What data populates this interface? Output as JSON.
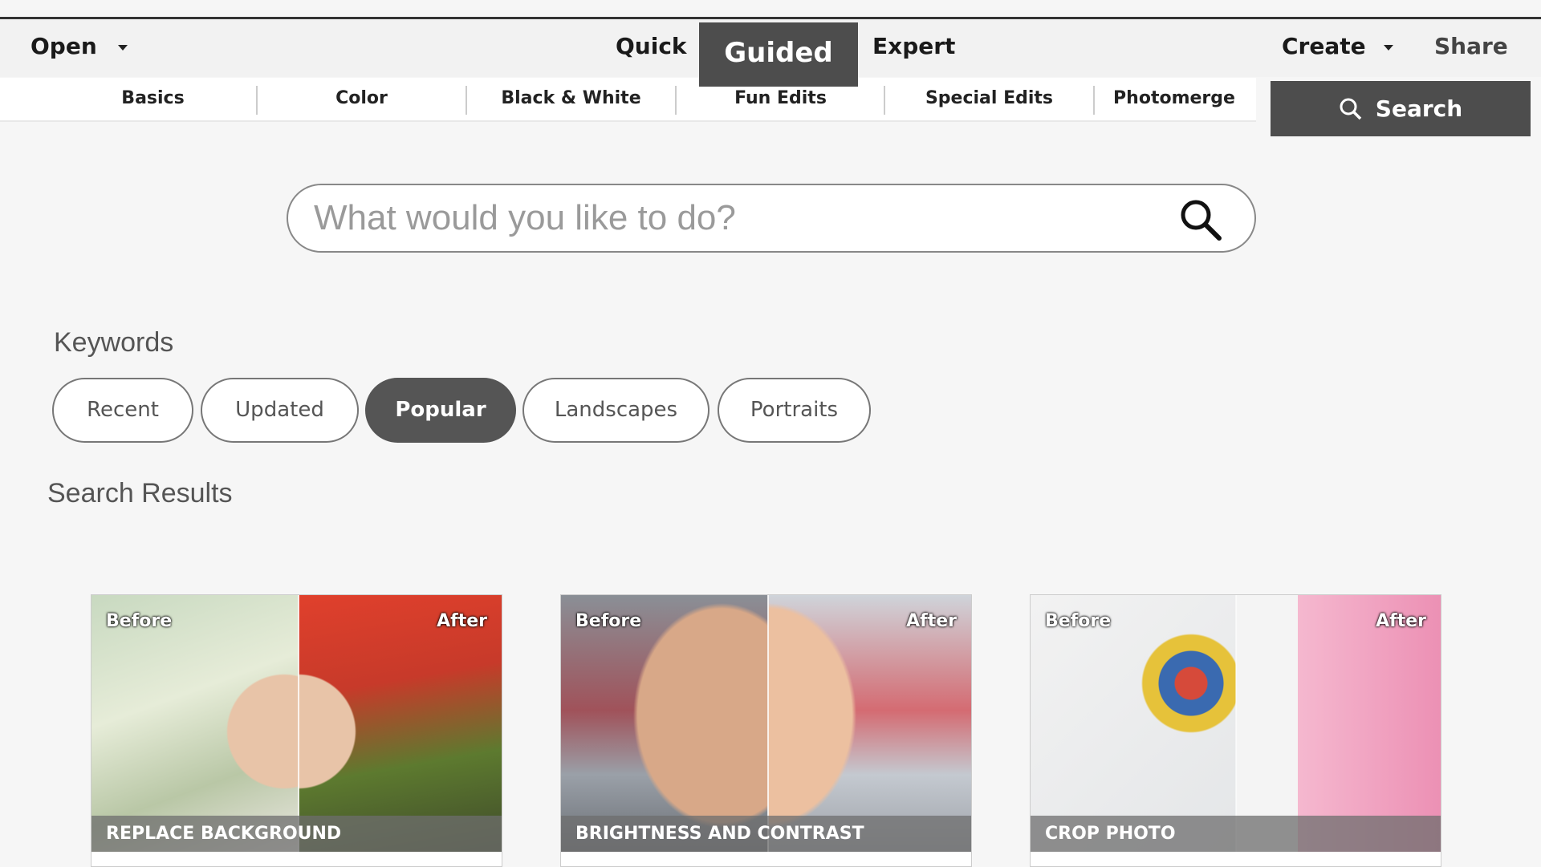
{
  "header": {
    "open": "Open",
    "modes": [
      "Quick",
      "Guided",
      "Expert"
    ],
    "active_mode": "Guided",
    "create": "Create",
    "share": "Share"
  },
  "subnav": {
    "items": [
      "Basics",
      "Color",
      "Black & White",
      "Fun Edits",
      "Special Edits",
      "Photomerge"
    ],
    "search_button": "Search"
  },
  "search": {
    "placeholder": "What would you like to do?",
    "value": ""
  },
  "keywords": {
    "title": "Keywords",
    "items": [
      "Recent",
      "Updated",
      "Popular",
      "Landscapes",
      "Portraits"
    ],
    "active": "Popular"
  },
  "results": {
    "title": "Search Results",
    "before_label": "Before",
    "after_label": "After",
    "cards": [
      {
        "title": "REPLACE BACKGROUND"
      },
      {
        "title": "BRIGHTNESS AND CONTRAST"
      },
      {
        "title": "CROP PHOTO"
      }
    ]
  },
  "colors": {
    "accent_dark": "#4d4d4d",
    "background": "#f6f6f6"
  }
}
